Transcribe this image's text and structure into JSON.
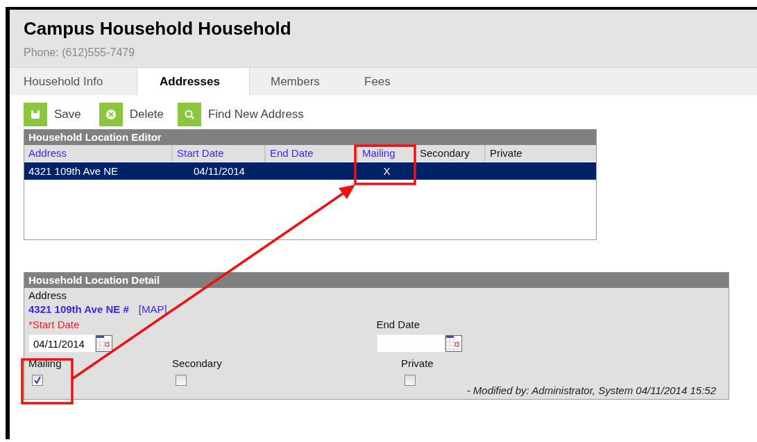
{
  "header": {
    "title": "Campus Household Household",
    "phone": "Phone: (612)555-7479"
  },
  "tabs": [
    {
      "label": "Household Info",
      "selected": false
    },
    {
      "label": "Addresses",
      "selected": true
    },
    {
      "label": "Members",
      "selected": false
    },
    {
      "label": "Fees",
      "selected": false
    }
  ],
  "toolbar": [
    {
      "label": "Save",
      "kind": "save"
    },
    {
      "label": "Delete",
      "kind": "delete"
    },
    {
      "label": "Find New Address",
      "kind": "search"
    }
  ],
  "editor": {
    "title": "Household Location Editor",
    "columns": [
      {
        "label": "Address",
        "sortable": true
      },
      {
        "label": "Start Date",
        "sortable": true
      },
      {
        "label": "End Date",
        "sortable": true
      },
      {
        "label": "Mailing",
        "sortable": true
      },
      {
        "label": "Secondary",
        "sortable": false
      },
      {
        "label": "Private",
        "sortable": false
      }
    ],
    "rows": [
      {
        "selected": true,
        "cells": [
          "4321 109th Ave NE",
          "04/11/2014",
          null,
          "X",
          null,
          null
        ]
      }
    ]
  },
  "detail": {
    "title": "Household Location Detail",
    "address_label": "Address",
    "address": "4321 109th Ave NE #",
    "map_link": "[MAP]",
    "start_date": {
      "label": "*Start Date",
      "required": true,
      "value": "04/11/2014"
    },
    "end_date": {
      "label": "End Date",
      "required": false
    },
    "flags": [
      {
        "label": "Mailing",
        "checked": true
      },
      {
        "label": "Secondary",
        "checked": false
      },
      {
        "label": "Private",
        "checked": false
      }
    ],
    "modified": "- Modified by: Administrator, System 04/11/2014 15:52"
  }
}
